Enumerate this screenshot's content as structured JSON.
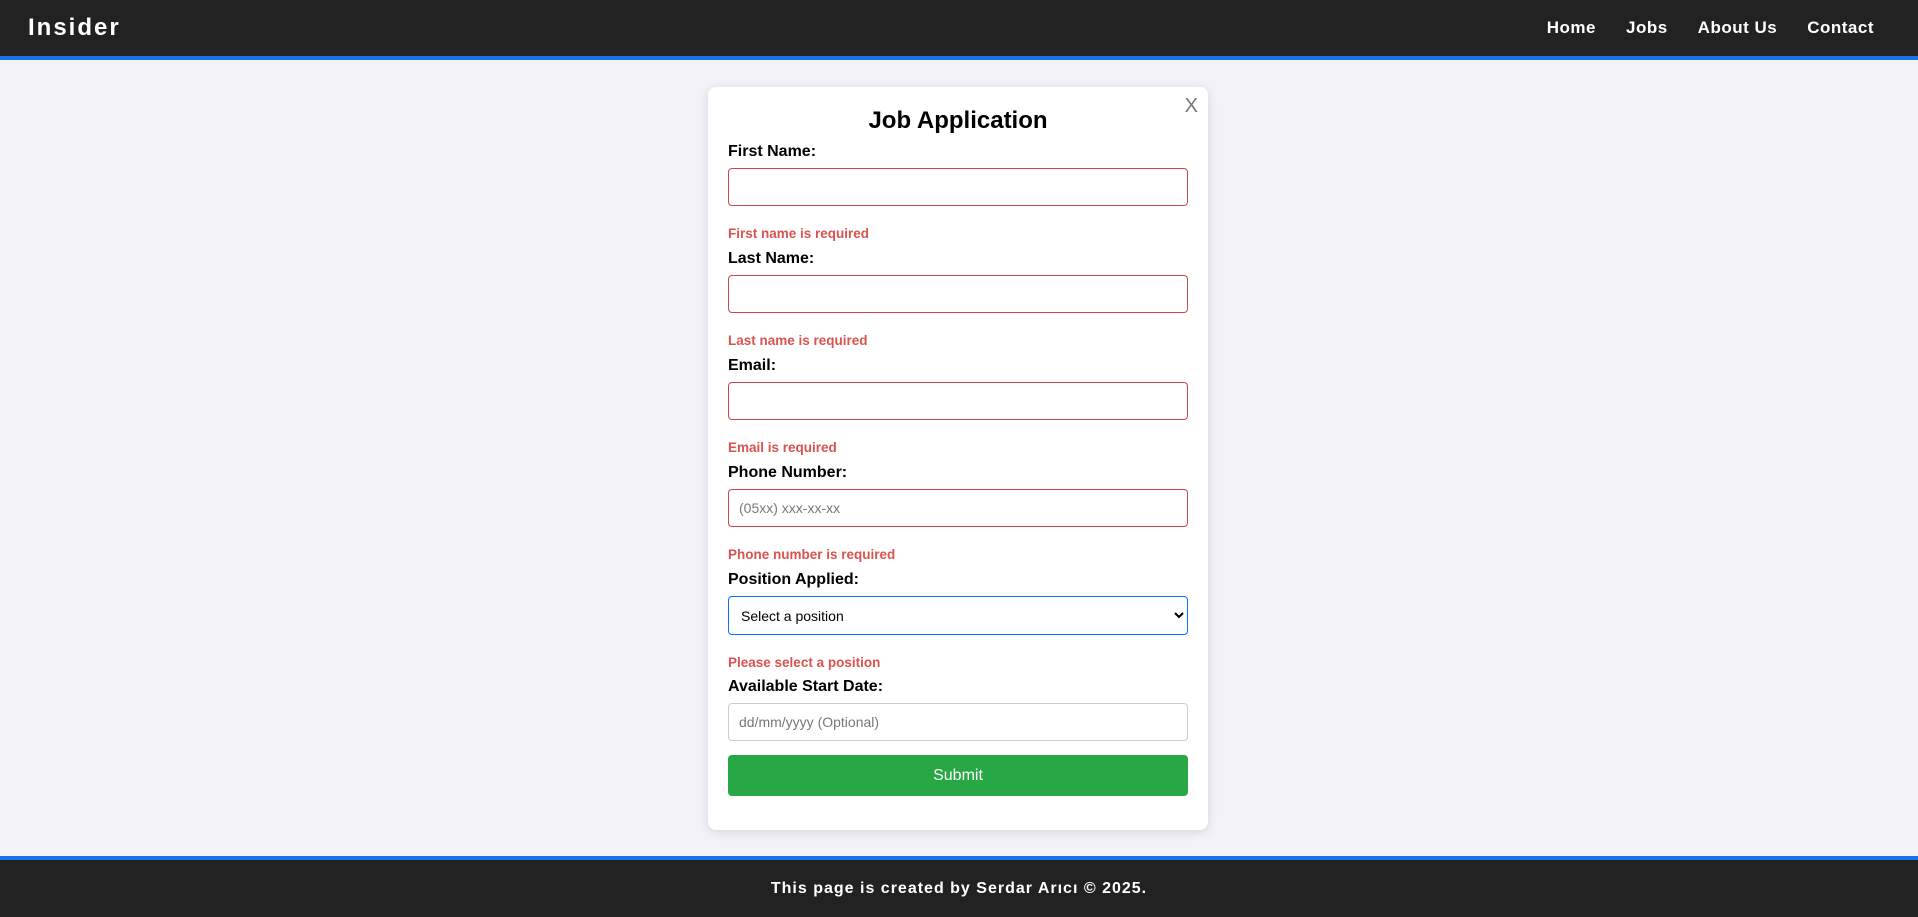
{
  "header": {
    "logo": "Insider",
    "nav": [
      "Home",
      "Jobs",
      "About Us",
      "Contact"
    ]
  },
  "form": {
    "title": "Job Application",
    "close_label": "X",
    "fields": [
      {
        "label": "First Name:",
        "placeholder": "",
        "error": "First name is required"
      },
      {
        "label": "Last Name:",
        "placeholder": "",
        "error": "Last name is required"
      },
      {
        "label": "Email:",
        "placeholder": "",
        "error": "Email is required"
      },
      {
        "label": "Phone Number:",
        "placeholder": "(05xx) xxx-xx-xx",
        "error": "Phone number is required"
      },
      {
        "label": "Position Applied:",
        "selected": "Select a position",
        "error": "Please select a position"
      },
      {
        "label": "Available Start Date:",
        "placeholder": "dd/mm/yyyy (Optional)"
      }
    ],
    "submit_label": "Submit"
  },
  "footer": {
    "text": "This page is created by Serdar Arıcı © 2025."
  },
  "colors": {
    "accent": "#1a73e8",
    "error": "#d9534f",
    "submit": "#28a745",
    "header": "#222222"
  }
}
